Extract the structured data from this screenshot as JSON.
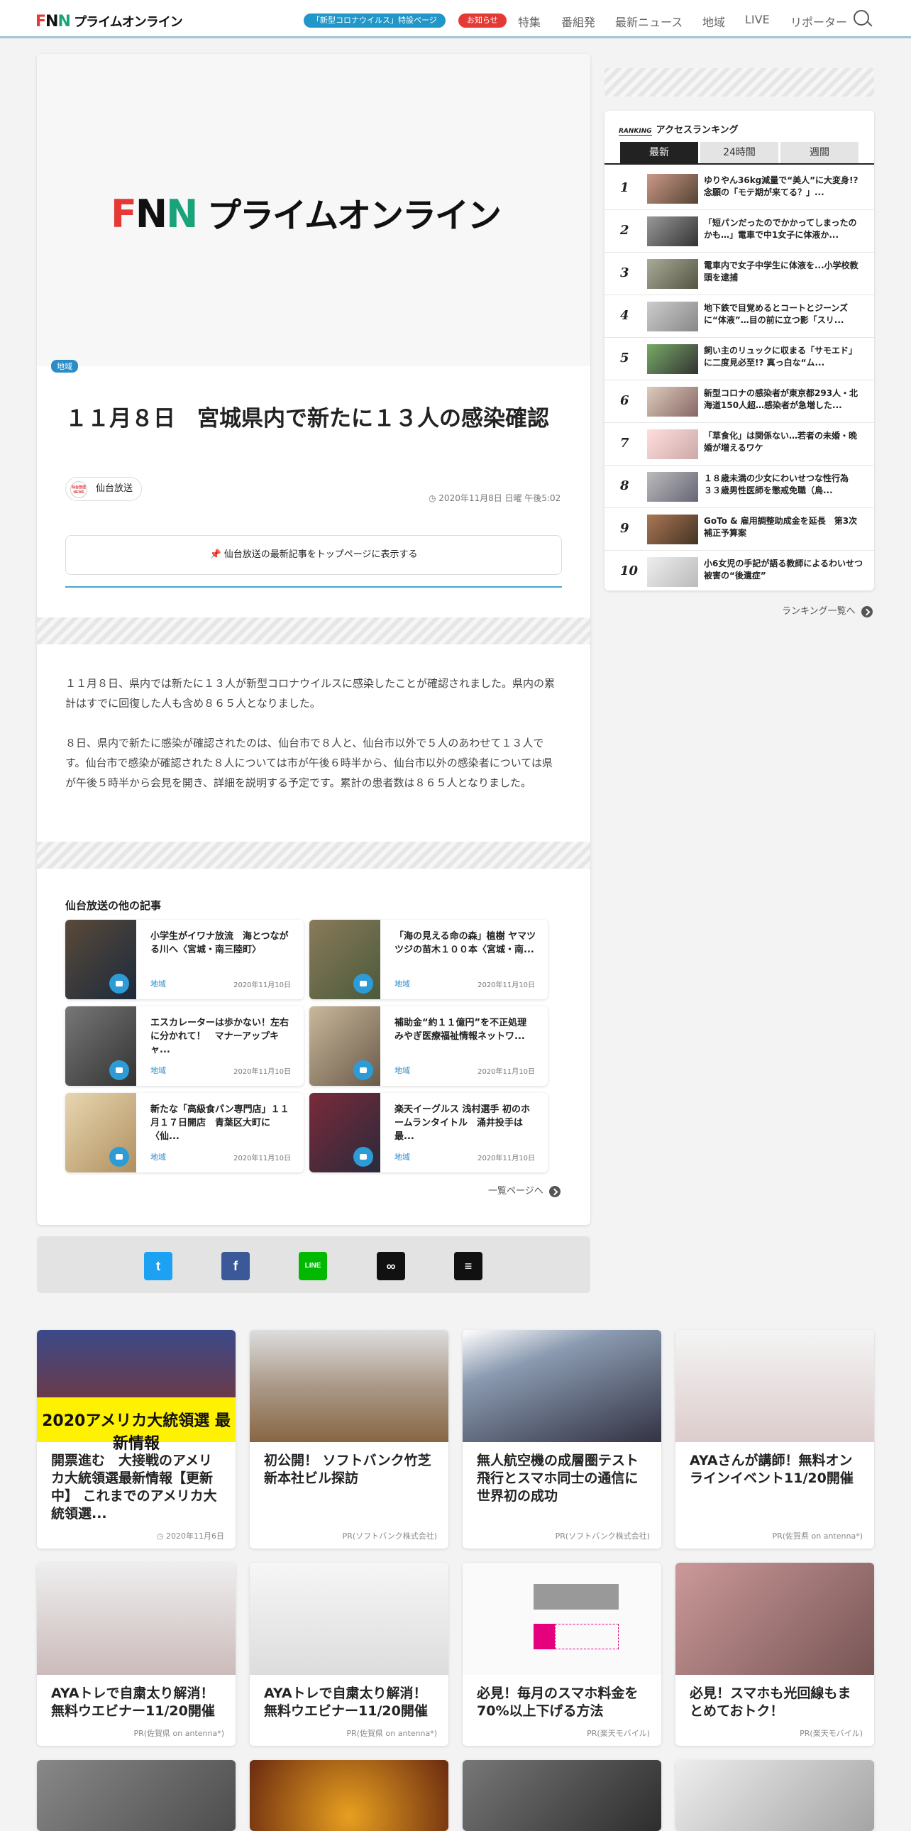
{
  "header": {
    "logo": "FNNプライムオンライン",
    "covid_link": "「新型コロナウイルス」特設ページ",
    "notice": "お知らせ",
    "nav": [
      "特集",
      "番組発",
      "最新ニュース",
      "地域",
      "LIVE",
      "リポーター"
    ]
  },
  "article": {
    "hero_logo": "FNNプライムオンライン",
    "category": "地域",
    "title": "１１月８日　宮城県内で新たに１３人の感染確認",
    "source": "仙台放送",
    "source_logo_text": "仙台放送NEWS",
    "date": "2020年11月8日 日曜 午後5:02",
    "top_button": "仙台放送の最新記事をトップページに表示する",
    "paragraphs": [
      "１１月８日、県内では新たに１３人が新型コロナウイルスに感染したことが確認されました。県内の累計はすでに回復した人も含め８６５人となりました。",
      "８日、県内で新たに感染が確認されたのは、仙台市で８人と、仙台市以外で５人のあわせて１３人です。仙台市で感染が確認された８人については市が午後６時半から、仙台市以外の感染者については県が午後５時半から会見を開き、詳細を説明する予定です。累計の患者数は８６５人となりました。"
    ]
  },
  "related": {
    "heading": "仙台放送の他の記事",
    "more": "一覧ページへ",
    "items": [
      {
        "title": "小学生がイワナ放流　海とつながる川へ〈宮城・南三陸町〉",
        "category": "地域",
        "date": "2020年11月10日"
      },
      {
        "title": "「海の見える命の森」植樹 ヤマツツジの苗木１００本〈宮城・南...",
        "category": "地域",
        "date": "2020年11月10日"
      },
      {
        "title": "エスカレーターは歩かない！左右に分かれて！　マナーアップキャ...",
        "category": "地域",
        "date": "2020年11月10日"
      },
      {
        "title": "補助金“約１１億円”を不正処理　みやぎ医療福祉情報ネットワ...",
        "category": "地域",
        "date": "2020年11月10日"
      },
      {
        "title": "新たな「高級食パン専門店」１１月１７日開店　青葉区大町に〈仙...",
        "category": "地域",
        "date": "2020年11月10日"
      },
      {
        "title": "楽天イーグルス 浅村選手 初のホームランタイトル　涌井投手は最...",
        "category": "地域",
        "date": "2020年11月10日"
      }
    ]
  },
  "share": {
    "buttons": [
      "twitter-icon",
      "facebook-icon",
      "line-icon",
      "link-icon",
      "comment-icon"
    ],
    "colors": [
      "#1da1f2",
      "#3b5998",
      "#00b900",
      "#111111",
      "#111111"
    ]
  },
  "ranking": {
    "label": "RANKING",
    "heading": "アクセスランキング",
    "tabs": [
      "最新",
      "24時間",
      "週間"
    ],
    "more": "ランキング一覧へ",
    "items": [
      {
        "num": "1",
        "title": "ゆりやん36kg減量で“美人”に大変身!? 念願の「モテ期が来てる？」..."
      },
      {
        "num": "2",
        "title": "「短パンだったのでかかってしまったのかも…」電車で中1女子に体液か..."
      },
      {
        "num": "3",
        "title": "電車内で女子中学生に体液を...小学校教頭を逮捕"
      },
      {
        "num": "4",
        "title": "地下鉄で目覚めるとコートとジーンズに“体液”…目の前に立つ影「スリ..."
      },
      {
        "num": "5",
        "title": "飼い主のリュックに収まる「サモエド」に二度見必至!? 真っ白な“ム..."
      },
      {
        "num": "6",
        "title": "新型コロナの感染者が東京都293人・北海道150人超…感染者が急増した..."
      },
      {
        "num": "7",
        "title": "「草食化」は関係ない…若者の未婚・晩婚が増えるワケ"
      },
      {
        "num": "8",
        "title": "１８歳未満の少女にわいせつな性行為　３３歳男性医師を懲戒免職（鳥..."
      },
      {
        "num": "9",
        "title": "GoTo & 雇用調整助成金を延長　第3次補正予算案"
      },
      {
        "num": "10",
        "title": "小6女児の手記が語る教師によるわいせつ被害の“後遺症”"
      }
    ]
  },
  "ads": [
    {
      "title": "開票進む　大接戦のアメリカ大統領選最新情報【更新中】 これまでのアメリカ大統領選...",
      "source": "2020年11月6日",
      "img_text": "2020アメリカ大統領選 最新情報"
    },
    {
      "title": "初公開！ ソフトバンク竹芝新本社ビル探訪",
      "source": "PR(ソフトバンク株式会社)"
    },
    {
      "title": "無人航空機の成層圏テスト飛行とスマホ同士の通信に世界初の成功",
      "source": "PR(ソフトバンク株式会社)"
    },
    {
      "title": "AYAさんが講師！無料オンラインイベント11/20開催",
      "source": "PR(佐賀県 on antenna*)"
    },
    {
      "title": "AYAトレで自粛太り解消！無料ウエビナー11/20開催",
      "source": "PR(佐賀県 on antenna*)"
    },
    {
      "title": "AYAトレで自粛太り解消！無料ウエビナー11/20開催",
      "source": "PR(佐賀県 on antenna*)"
    },
    {
      "title": "必見！毎月のスマホ料金を70%以上下げる方法",
      "source": "PR(楽天モバイル)"
    },
    {
      "title": "必見！スマホも光回線もまとめておトク！",
      "source": "PR(楽天モバイル)"
    }
  ]
}
